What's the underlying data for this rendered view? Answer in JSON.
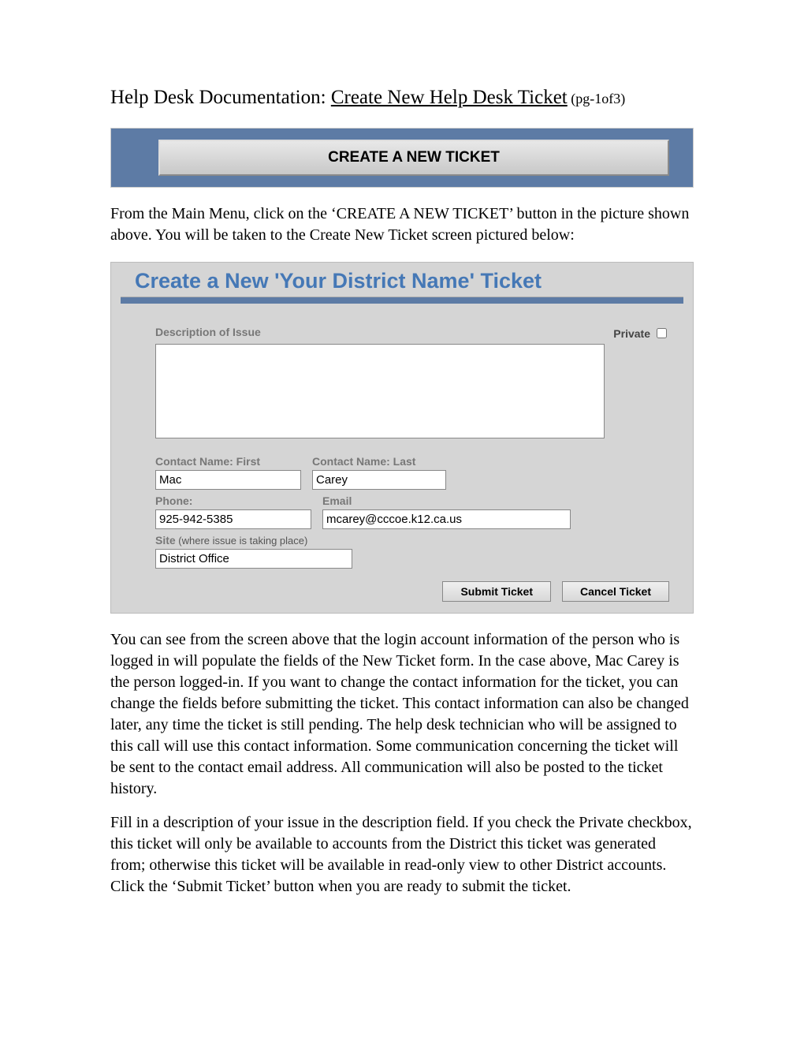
{
  "doc_title_prefix": "Help Desk Documentation:  ",
  "doc_title_main": "Create New Help Desk Ticket",
  "doc_title_pg": " (pg-1of3)",
  "banner_button": "CREATE A NEW TICKET",
  "intro_paragraph": "From the Main Menu, click on the ‘CREATE A NEW TICKET’ button in the picture shown above.  You will be taken to the Create New Ticket screen pictured below:",
  "form": {
    "title": "Create a New 'Your District Name' Ticket",
    "labels": {
      "description": "Description of Issue",
      "private": "Private",
      "first": "Contact Name: First",
      "last": "Contact Name: Last",
      "phone": "Phone:",
      "email": "Email",
      "site": "Site",
      "site_note": " (where issue is taking place)"
    },
    "values": {
      "description": "",
      "private_checked": false,
      "first": "Mac",
      "last": "Carey",
      "phone": "925-942-5385",
      "email": "mcarey@cccoe.k12.ca.us",
      "site": "District Office"
    },
    "buttons": {
      "submit": "Submit Ticket",
      "cancel": "Cancel Ticket"
    }
  },
  "paragraph2": "You can see from the screen above that the login account information of the person who is logged in will populate the fields of the New Ticket form. In the case above, Mac Carey is the person logged-in. If you want to change the contact information for the ticket, you can change the fields before submitting the ticket. This contact information can also be changed later, any time the ticket is still pending. The help desk technician who will be assigned to this call will use this contact information. Some communication concerning the ticket will be sent to the contact email address. All communication will also be posted to the ticket history.",
  "paragraph3": "Fill in a description of your issue in the description field. If you check the Private checkbox, this ticket will only be available to accounts from the District this ticket was generated from; otherwise this ticket will be available in read-only view to other District accounts. Click the ‘Submit Ticket’ button when you are ready to submit the ticket."
}
